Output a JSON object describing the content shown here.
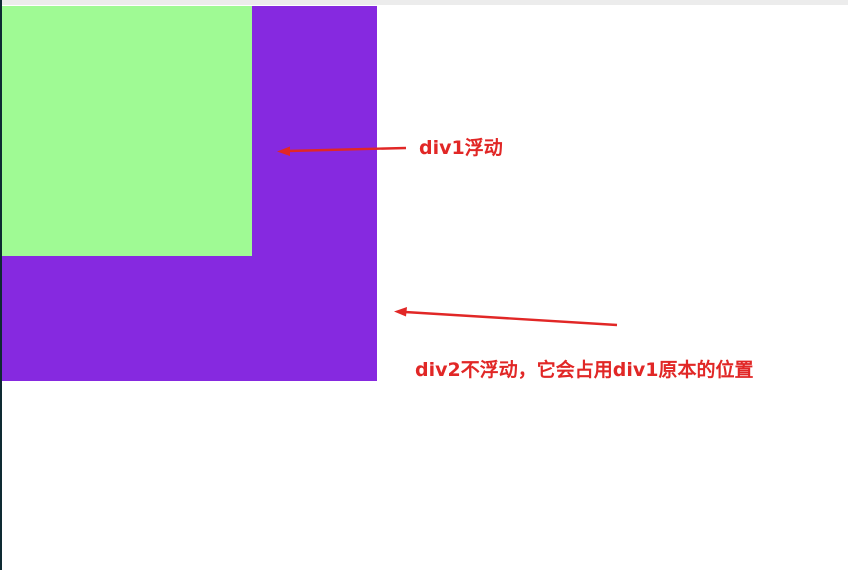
{
  "colors": {
    "div1": "#9ffa94",
    "div2": "#8629e0",
    "annotation": "#e12726"
  },
  "annotations": {
    "div1_label": "div1浮动",
    "div2_label": "div2不浮动，它会占用div1原本的位置"
  }
}
